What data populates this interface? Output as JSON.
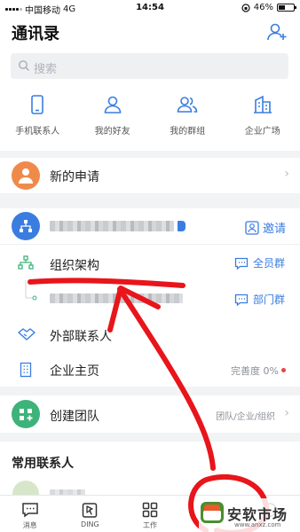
{
  "status_bar": {
    "carrier": "中国移动",
    "network": "4G",
    "time": "14:54",
    "battery": "46%",
    "battery_level": 0.46
  },
  "header": {
    "title": "通讯录"
  },
  "search": {
    "placeholder": "搜索"
  },
  "quick_actions": [
    {
      "label": "手机联系人",
      "icon": "phone-icon"
    },
    {
      "label": "我的好友",
      "icon": "person-icon"
    },
    {
      "label": "我的群组",
      "icon": "group-icon"
    },
    {
      "label": "企业广场",
      "icon": "building-icon"
    }
  ],
  "new_request": {
    "label": "新的申请"
  },
  "org": {
    "invite_label": "邀请",
    "structure_label": "组织架构",
    "all_group_label": "全员群",
    "dept_group_label": "部门群",
    "external_label": "外部联系人",
    "homepage_label": "企业主页",
    "completeness_label": "完善度 0%"
  },
  "create_team": {
    "label": "创建团队",
    "hint": "团队/企业/组织"
  },
  "frequent": {
    "title": "常用联系人"
  },
  "tabbar": [
    {
      "label": "消息",
      "icon": "message-icon"
    },
    {
      "label": "DING",
      "icon": "ding-icon"
    },
    {
      "label": "工作",
      "icon": "grid-icon"
    },
    {
      "label": "",
      "icon": "contacts-icon"
    },
    {
      "label": "",
      "icon": "me-icon"
    }
  ],
  "watermark": {
    "text": "安软市场",
    "url": "www.anxz.com"
  },
  "colors": {
    "accent": "#3a7de0",
    "orange": "#f08a4b",
    "green": "#3db37a",
    "annotation": "#e8151b",
    "badge": "#e54545"
  }
}
